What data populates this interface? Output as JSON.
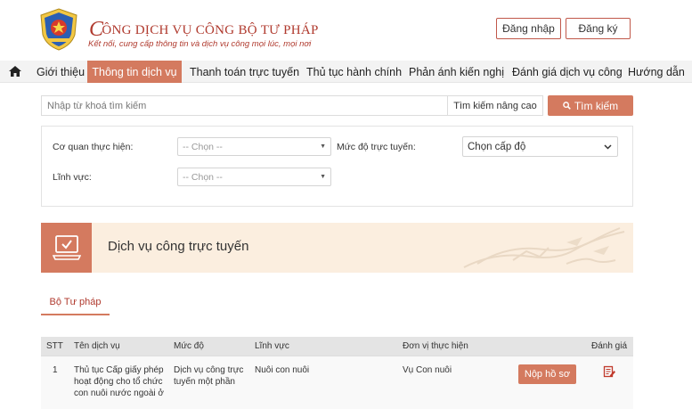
{
  "header": {
    "title_first_letter": "C",
    "title_rest": "ÔNG DỊCH VỤ CÔNG BỘ TƯ PHÁP",
    "subtitle": "Kết nối, cung cấp thông tin và dịch vụ công mọi lúc, mọi nơi",
    "login_label": "Đăng nhập",
    "register_label": "Đăng ký"
  },
  "nav": {
    "items": [
      {
        "label": "Giới thiệu"
      },
      {
        "label": "Thông tin dịch vụ",
        "active": true
      },
      {
        "label": "Thanh toán trực tuyến"
      },
      {
        "label": "Thủ tục hành chính"
      },
      {
        "label": "Phản ánh kiến nghị"
      },
      {
        "label": "Đánh giá dịch vụ công"
      },
      {
        "label": "Hướng dẫn"
      }
    ]
  },
  "search": {
    "placeholder": "Nhập từ khoá tìm kiếm",
    "advanced_label": "Tìm kiếm nâng cao",
    "button_label": "Tìm kiếm"
  },
  "filters": {
    "agency_label": "Cơ quan thực hiện:",
    "agency_value": "-- Chọn --",
    "level_label": "Mức độ trực tuyến:",
    "level_value": "Chọn cấp độ",
    "field_label": "Lĩnh vực:",
    "field_value": "-- Chọn --"
  },
  "banner": {
    "title": "Dịch vụ công trực tuyến"
  },
  "tabs": {
    "active_label": "Bộ Tư pháp"
  },
  "table": {
    "headers": [
      "STT",
      "Tên dịch vụ",
      "Mức độ",
      "Lĩnh vực",
      "Đơn vị thực hiện",
      "Đánh giá"
    ],
    "rows": [
      {
        "stt": "1",
        "name_lines": [
          "Thủ tục Cấp giấy phép",
          "hoạt động cho tổ chức",
          "con nuôi nước ngoài ở"
        ],
        "level_lines": [
          "Dịch vụ công trực",
          "tuyến một phần"
        ],
        "field": "Nuôi con nuôi",
        "unit": "Vụ Con nuôi",
        "action_label": "Nộp hồ sơ"
      }
    ]
  },
  "colors": {
    "accent": "#d47a5f",
    "brand_red": "#b03a2e",
    "banner_bg": "#fbeedf"
  }
}
